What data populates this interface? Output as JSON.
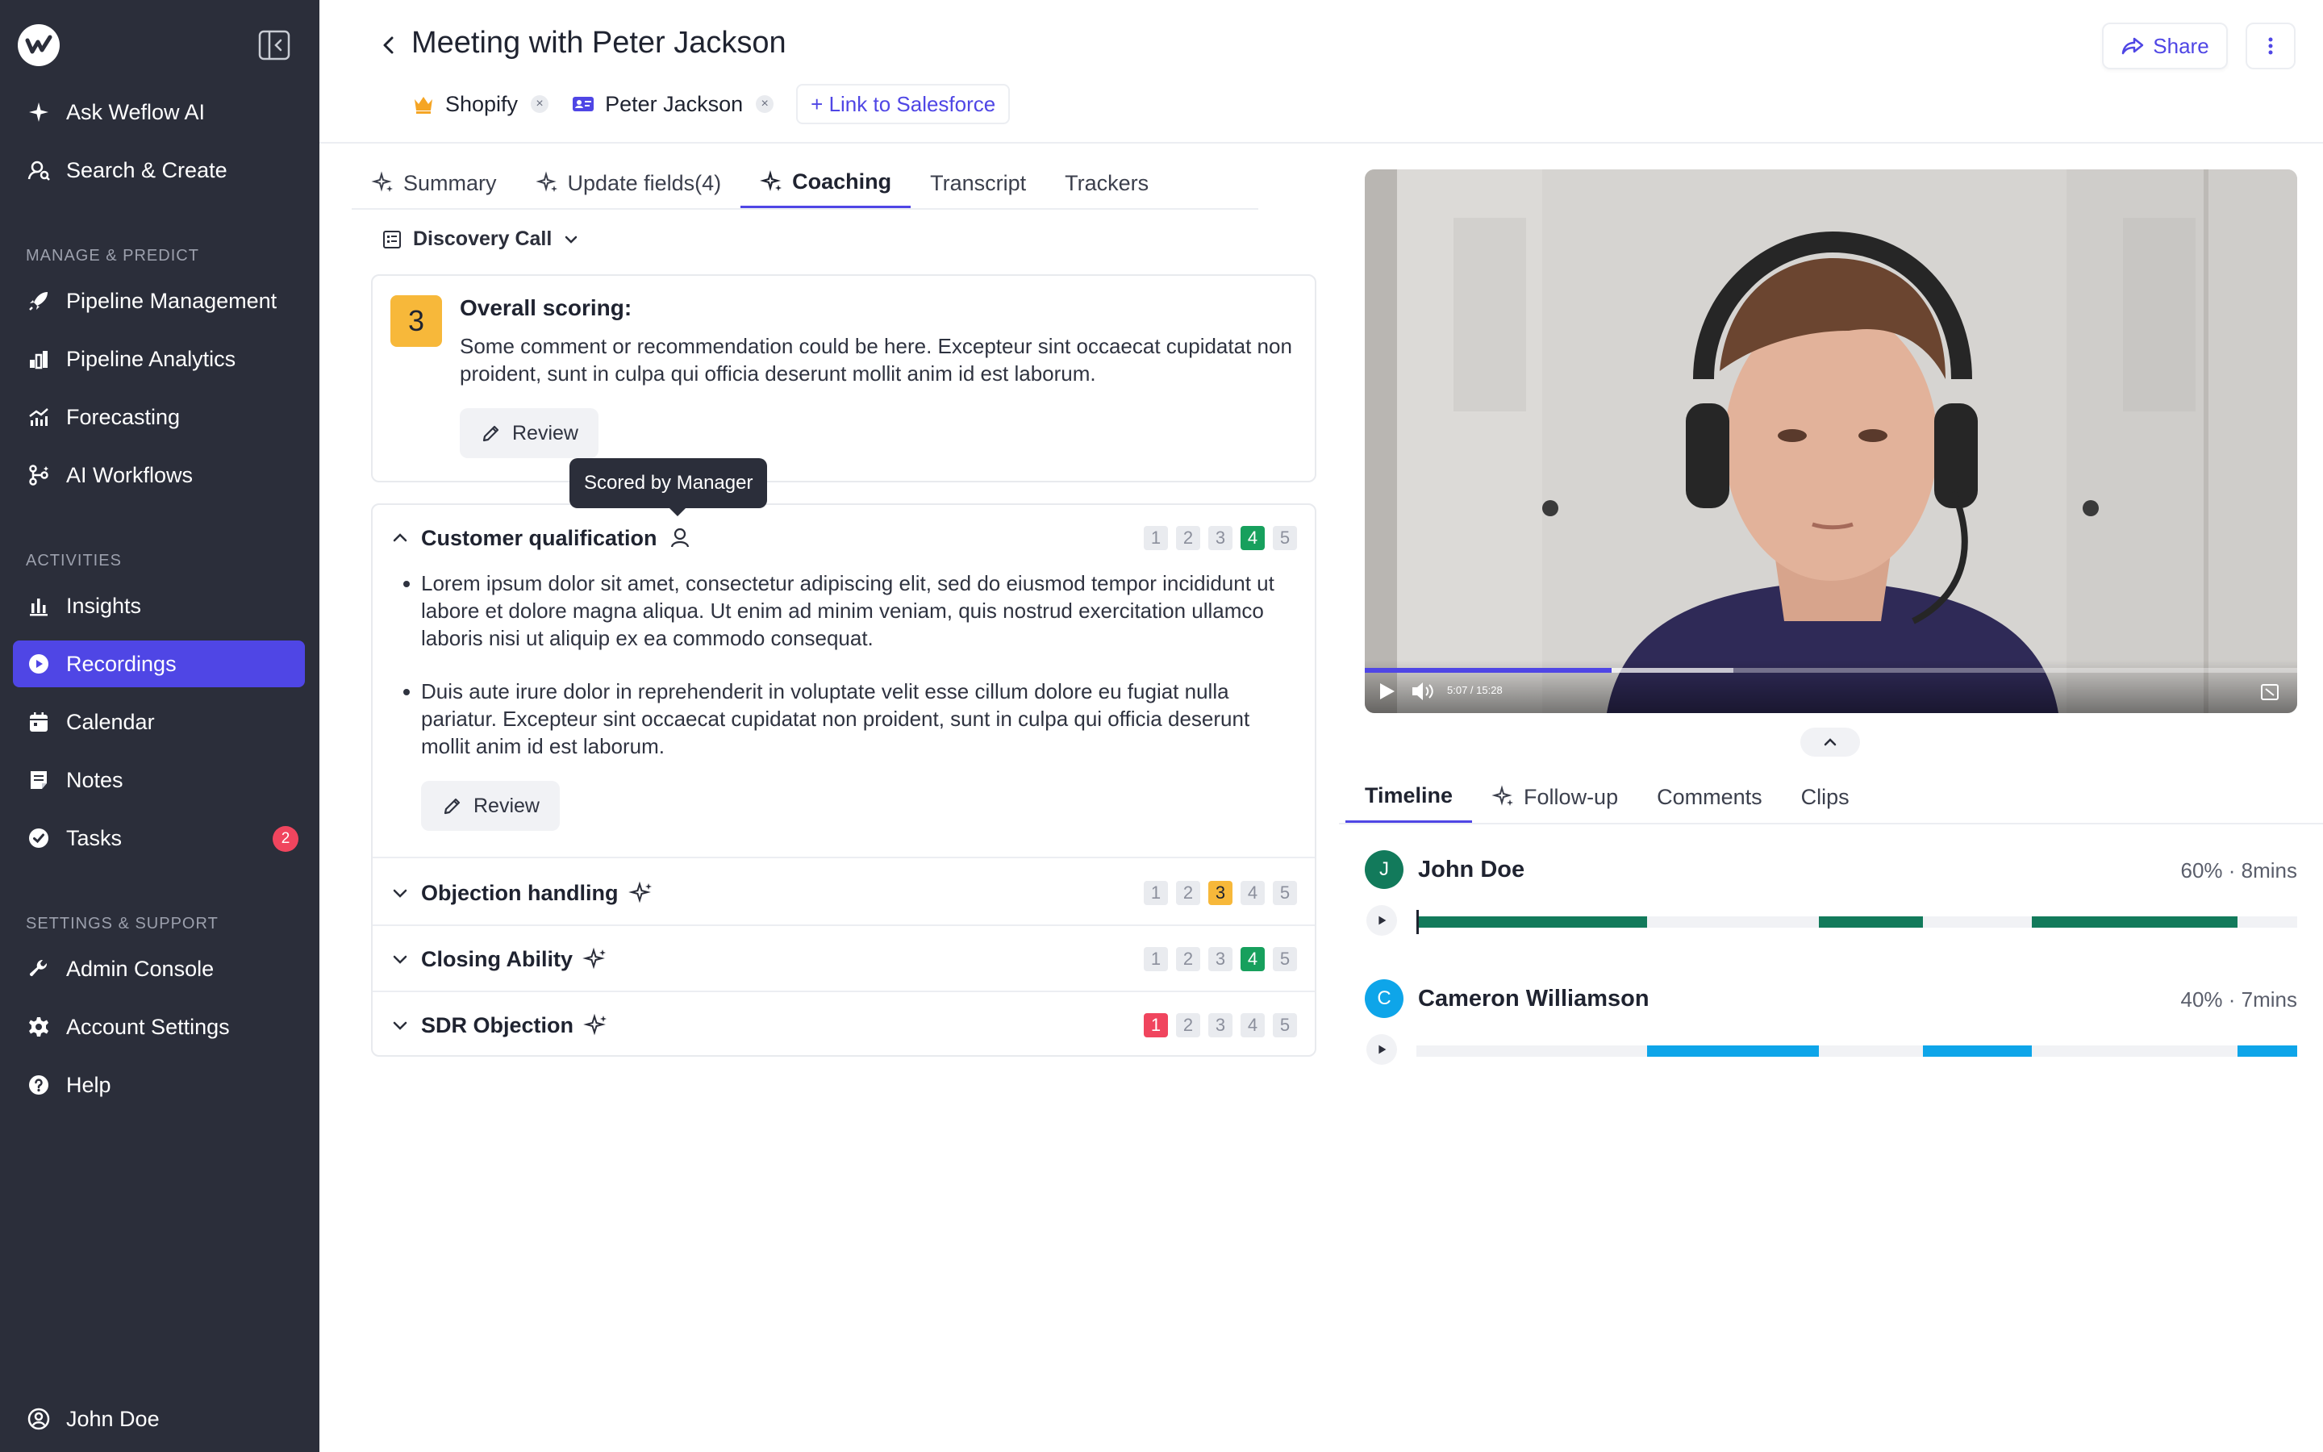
{
  "sidebar": {
    "top_items": [
      {
        "label": "Ask Weflow AI",
        "icon": "sparkle-icon"
      },
      {
        "label": "Search & Create",
        "icon": "search-user-icon"
      }
    ],
    "sections": [
      {
        "title": "MANAGE & PREDICT",
        "items": [
          {
            "label": "Pipeline Management",
            "icon": "rocket-icon"
          },
          {
            "label": "Pipeline Analytics",
            "icon": "analytics-icon"
          },
          {
            "label": "Forecasting",
            "icon": "forecast-icon"
          },
          {
            "label": "AI Workflows",
            "icon": "workflow-icon"
          }
        ]
      },
      {
        "title": "ACTIVITIES",
        "items": [
          {
            "label": "Insights",
            "icon": "bar-chart-icon"
          },
          {
            "label": "Recordings",
            "icon": "play-circle-icon",
            "active": true
          },
          {
            "label": "Calendar",
            "icon": "calendar-icon"
          },
          {
            "label": "Notes",
            "icon": "notes-icon"
          },
          {
            "label": "Tasks",
            "icon": "check-circle-icon",
            "badge": "2"
          }
        ]
      },
      {
        "title": "SETTINGS & SUPPORT",
        "items": [
          {
            "label": "Admin Console",
            "icon": "wrench-icon"
          },
          {
            "label": "Account Settings",
            "icon": "gear-icon"
          },
          {
            "label": "Help",
            "icon": "help-icon"
          }
        ]
      }
    ],
    "user": {
      "label": "John Doe",
      "icon": "user-circle-icon"
    }
  },
  "header": {
    "title": "Meeting with Peter Jackson",
    "chips": [
      {
        "label": "Shopify",
        "icon": "crown-icon"
      },
      {
        "label": "Peter Jackson",
        "icon": "contact-card-icon"
      }
    ],
    "link_label": "+ Link to Salesforce",
    "share_label": "Share"
  },
  "tabs": [
    {
      "label": "Summary",
      "ai": true
    },
    {
      "label": "Update fields(4)",
      "ai": true
    },
    {
      "label": "Coaching",
      "ai": true,
      "active": true
    },
    {
      "label": "Transcript",
      "ai": false
    },
    {
      "label": "Trackers",
      "ai": false
    }
  ],
  "scorecard_select": "Discovery Call",
  "overall": {
    "score": "3",
    "heading": "Overall scoring:",
    "text": "Some comment or recommendation could be here. Excepteur sint occaecat cupidatat non proident, sunt in culpa qui officia deserunt mollit anim id est laborum.",
    "review_label": "Review"
  },
  "tooltip": "Scored by Manager",
  "criteria": [
    {
      "title": "Customer qualification",
      "scored_by": "manager",
      "score": 4,
      "expanded": true,
      "bullets": [
        "Lorem ipsum dolor sit amet, consectetur adipiscing elit, sed do eiusmod tempor incididunt ut labore et dolore magna aliqua. Ut enim ad minim veniam, quis nostrud exercitation ullamco laboris nisi ut aliquip ex ea commodo consequat.",
        "Duis aute irure dolor in reprehenderit in voluptate velit esse cillum dolore eu fugiat nulla pariatur. Excepteur sint occaecat cupidatat non proident, sunt in culpa qui officia deserunt mollit anim id est laborum."
      ],
      "review_label": "Review"
    },
    {
      "title": "Objection handling",
      "scored_by": "ai",
      "score": 3,
      "expanded": false
    },
    {
      "title": "Closing Ability",
      "scored_by": "ai",
      "score": 4,
      "expanded": false
    },
    {
      "title": "SDR Objection",
      "scored_by": "ai",
      "score": 1,
      "expanded": false
    }
  ],
  "scale": [
    "1",
    "2",
    "3",
    "4",
    "5"
  ],
  "colors": {
    "accent": "#4f46e5",
    "good": "#17a05d",
    "medium": "#f7b83a",
    "bad": "#f0455e",
    "speaker1": "#127a5b",
    "speaker2": "#0ea5e9"
  },
  "video": {
    "time": "5:07 / 15:28",
    "progress": 0.265,
    "buffered": 0.395
  },
  "right_tabs": [
    {
      "label": "Timeline",
      "active": true
    },
    {
      "label": "Follow-up",
      "ai": true
    },
    {
      "label": "Comments"
    },
    {
      "label": "Clips"
    }
  ],
  "speakers": [
    {
      "initial": "J",
      "name": "John Doe",
      "stats": "60% · 8mins",
      "color": "#127a5b",
      "segments": [
        [
          0,
          0.262
        ],
        [
          0.457,
          0.575
        ],
        [
          0.699,
          0.932
        ]
      ]
    },
    {
      "initial": "C",
      "name": "Cameron Williamson",
      "stats": "40% · 7mins",
      "color": "#0ea5e9",
      "segments": [
        [
          0.262,
          0.457
        ],
        [
          0.575,
          0.699
        ],
        [
          0.932,
          1.0
        ]
      ]
    }
  ]
}
